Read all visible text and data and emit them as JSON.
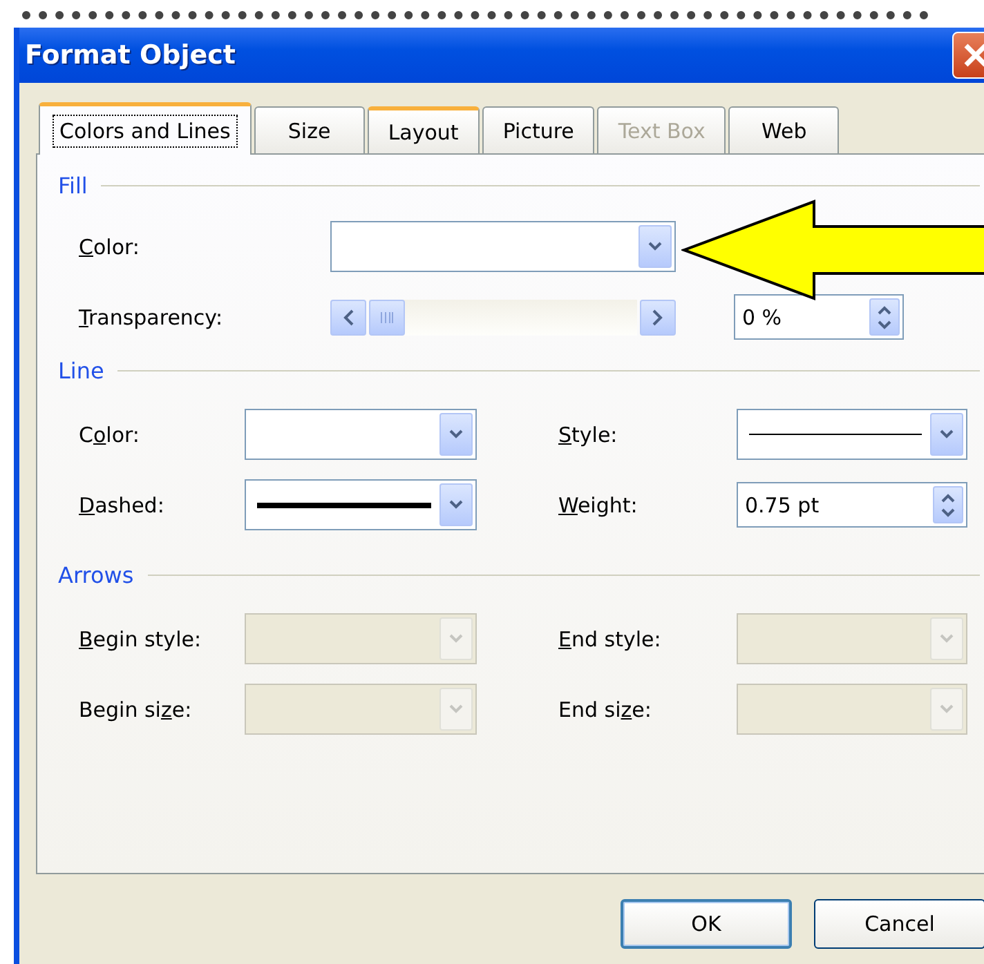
{
  "window": {
    "title": "Format Object"
  },
  "tabs": [
    {
      "label": "Colors and Lines",
      "selected": true,
      "disabled": false,
      "hot": false
    },
    {
      "label": "Size",
      "selected": false,
      "disabled": false,
      "hot": false
    },
    {
      "label": "Layout",
      "selected": false,
      "disabled": false,
      "hot": true
    },
    {
      "label": "Picture",
      "selected": false,
      "disabled": false,
      "hot": false
    },
    {
      "label": "Text Box",
      "selected": false,
      "disabled": true,
      "hot": false
    },
    {
      "label": "Web",
      "selected": false,
      "disabled": false,
      "hot": false
    }
  ],
  "sections": [
    {
      "title": "Fill",
      "fields": [
        {
          "kind": "combo",
          "label": {
            "key": "C",
            "after": "olor:"
          },
          "disabled": false
        },
        {
          "kind": "slider",
          "label": {
            "key": "T",
            "after": "ransparency:"
          },
          "level": 0,
          "reading": "0 %"
        }
      ]
    },
    {
      "title": "Line",
      "fields": [
        {
          "kind": "combo",
          "label": {
            "before": "C",
            "key": "o",
            "after": "lor:"
          },
          "disabled": false
        },
        {
          "kind": "thin-line-combo",
          "label": {
            "key": "S",
            "after": "tyle:"
          },
          "disabled": false
        },
        {
          "kind": "thick-line-combo",
          "label": {
            "key": "D",
            "after": "ashed:"
          },
          "disabled": false
        },
        {
          "kind": "spin",
          "label": {
            "key": "W",
            "after": "eight:"
          },
          "value": "0.75 pt"
        }
      ]
    },
    {
      "title": "Arrows",
      "fields": [
        {
          "kind": "combo",
          "label": {
            "key": "B",
            "after": "egin style:"
          },
          "disabled": true
        },
        {
          "kind": "combo",
          "label": {
            "key": "E",
            "after": "nd style:"
          },
          "disabled": true
        },
        {
          "kind": "combo",
          "label": {
            "before": "Begin si",
            "key": "z",
            "after": "e:"
          },
          "disabled": true
        },
        {
          "kind": "combo",
          "label": {
            "before": "End si",
            "key": "z",
            "after": "e:"
          },
          "disabled": true
        }
      ]
    }
  ],
  "buttons": [
    {
      "label": "OK",
      "default": true
    },
    {
      "label": "Cancel",
      "default": false
    }
  ],
  "annotation": {
    "kind": "arrow"
  }
}
